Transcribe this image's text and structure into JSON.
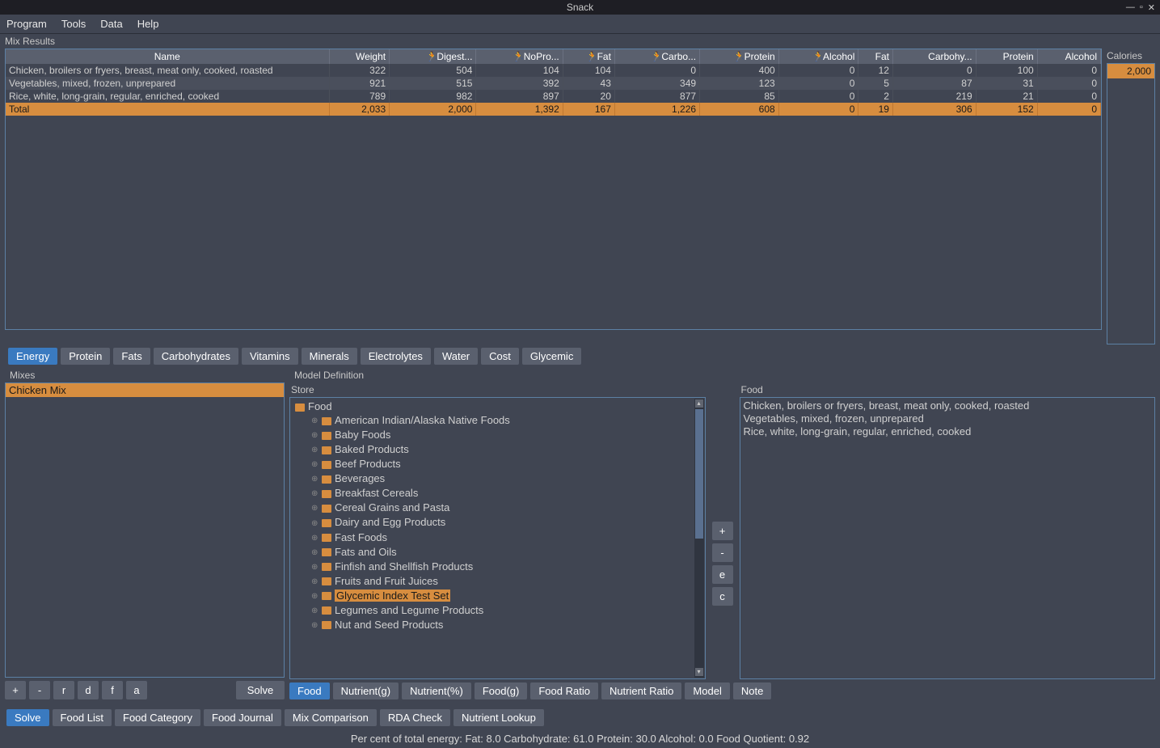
{
  "window": {
    "title": "Snack"
  },
  "menu": {
    "program": "Program",
    "tools": "Tools",
    "data": "Data",
    "help": "Help"
  },
  "labels": {
    "mix_results": "Mix Results",
    "calories": "Calories",
    "mixes": "Mixes",
    "model_def": "Model Definition",
    "store": "Store",
    "food": "Food"
  },
  "calories": {
    "value": "2,000"
  },
  "table": {
    "headers": [
      "Name",
      "Weight",
      "Digest...",
      "NoPro...",
      "Fat",
      "Carbo...",
      "Protein",
      "Alcohol",
      "Fat",
      "Carbohy...",
      "Protein",
      "Alcohol"
    ],
    "rows": [
      [
        "Chicken, broilers or fryers, breast, meat only, cooked, roasted",
        "322",
        "504",
        "104",
        "104",
        "0",
        "400",
        "0",
        "12",
        "0",
        "100",
        "0"
      ],
      [
        "Vegetables, mixed, frozen, unprepared",
        "921",
        "515",
        "392",
        "43",
        "349",
        "123",
        "0",
        "5",
        "87",
        "31",
        "0"
      ],
      [
        "Rice, white, long-grain, regular, enriched, cooked",
        "789",
        "982",
        "897",
        "20",
        "877",
        "85",
        "0",
        "2",
        "219",
        "21",
        "0"
      ]
    ],
    "total": [
      "Total",
      "2,033",
      "2,000",
      "1,392",
      "167",
      "1,226",
      "608",
      "0",
      "19",
      "306",
      "152",
      "0"
    ]
  },
  "nutrient_tabs": [
    "Energy",
    "Protein",
    "Fats",
    "Carbohydrates",
    "Vitamins",
    "Minerals",
    "Electrolytes",
    "Water",
    "Cost",
    "Glycemic"
  ],
  "mixes": {
    "items": [
      "Chicken Mix"
    ]
  },
  "mix_btns": {
    "plus": "+",
    "minus": "-",
    "r": "r",
    "d": "d",
    "f": "f",
    "a": "a",
    "solve": "Solve"
  },
  "store": {
    "root": "Food",
    "items": [
      "American Indian/Alaska Native Foods",
      "Baby Foods",
      "Baked Products",
      "Beef Products",
      "Beverages",
      "Breakfast Cereals",
      "Cereal Grains and Pasta",
      "Dairy and Egg Products",
      "Fast Foods",
      "Fats and Oils",
      "Finfish and Shellfish Products",
      "Fruits and Fruit Juices",
      "Glycemic Index Test Set",
      "Legumes and Legume Products",
      "Nut and Seed Products"
    ]
  },
  "store_selected_index": 12,
  "model_btns": {
    "plus": "+",
    "minus": "-",
    "e": "e",
    "c": "c"
  },
  "food_items": [
    "Chicken, broilers or fryers, breast, meat only, cooked, roasted",
    "Vegetables, mixed, frozen, unprepared",
    "Rice, white, long-grain, regular, enriched, cooked"
  ],
  "model_tabs": [
    "Food",
    "Nutrient(g)",
    "Nutrient(%)",
    "Food(g)",
    "Food Ratio",
    "Nutrient Ratio",
    "Model",
    "Note"
  ],
  "main_tabs": [
    "Solve",
    "Food List",
    "Food Category",
    "Food Journal",
    "Mix Comparison",
    "RDA Check",
    "Nutrient Lookup"
  ],
  "status": "Per cent of total energy:     Fat: 8.0    Carbohydrate: 61.0    Protein: 30.0    Alcohol: 0.0        Food Quotient: 0.92"
}
